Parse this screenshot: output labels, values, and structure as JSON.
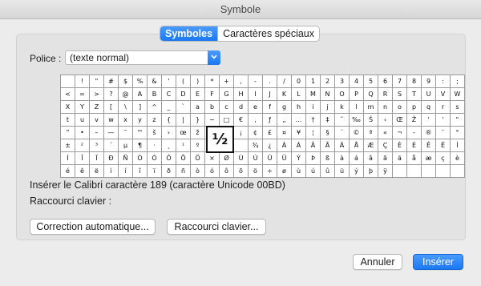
{
  "window": {
    "title": "Symbole"
  },
  "tabs": [
    {
      "label": "Symboles",
      "active": true
    },
    {
      "label": "Caractères spéciaux",
      "active": false
    }
  ],
  "police": {
    "label": "Police :",
    "value": "(texte normal)"
  },
  "symbol_grid": {
    "rows": [
      [
        "",
        "!",
        "\"",
        "#",
        "$",
        "%",
        "&",
        "'",
        "(",
        ")",
        "*",
        "+",
        ",",
        "-",
        ".",
        "/",
        "0",
        "1",
        "2",
        "3",
        "4",
        "5",
        "6",
        "7",
        "8",
        "9",
        ":",
        ";"
      ],
      [
        "<",
        "=",
        ">",
        "?",
        "@",
        "A",
        "B",
        "C",
        "D",
        "E",
        "F",
        "G",
        "H",
        "I",
        "J",
        "K",
        "L",
        "M",
        "N",
        "O",
        "P",
        "Q",
        "R",
        "S",
        "T",
        "U",
        "V",
        "W"
      ],
      [
        "X",
        "Y",
        "Z",
        "[",
        "\\",
        "]",
        "^",
        "_",
        "`",
        "a",
        "b",
        "c",
        "d",
        "e",
        "f",
        "g",
        "h",
        "i",
        "j",
        "k",
        "l",
        "m",
        "n",
        "o",
        "p",
        "q",
        "r",
        "s"
      ],
      [
        "t",
        "u",
        "v",
        "w",
        "x",
        "y",
        "z",
        "{",
        "|",
        "}",
        "~",
        "□",
        "€",
        ",",
        "ƒ",
        "„",
        "…",
        "†",
        "‡",
        "ˆ",
        "‰",
        "Š",
        "‹",
        "Œ",
        "Ž",
        "'",
        "'",
        "“"
      ],
      [
        "”",
        "•",
        "–",
        "—",
        "˜",
        "™",
        "š",
        "›",
        "œ",
        "ž",
        "Ÿ",
        "",
        "¡",
        "¢",
        "£",
        "¤",
        "¥",
        "¦",
        "§",
        "¨",
        "©",
        "ª",
        "«",
        "¬",
        "-",
        "®",
        "¯",
        "°"
      ],
      [
        "±",
        "²",
        "³",
        "´",
        "µ",
        "¶",
        "·",
        "¸",
        "¹",
        "º",
        "»",
        "¼",
        "",
        "¾",
        "¿",
        "À",
        "Á",
        "Â",
        "Ã",
        "Ä",
        "Å",
        "Æ",
        "Ç",
        "È",
        "É",
        "Ê",
        "Ë",
        "Ì"
      ],
      [
        "Í",
        "Î",
        "Ï",
        "Ð",
        "Ñ",
        "Ò",
        "Ó",
        "Ô",
        "Õ",
        "Ö",
        "×",
        "Ø",
        "Ù",
        "Ú",
        "Û",
        "Ü",
        "Ý",
        "Þ",
        "ß",
        "à",
        "á",
        "â",
        "ã",
        "ä",
        "å",
        "æ",
        "ç",
        "è"
      ],
      [
        "é",
        "ê",
        "ë",
        "ì",
        "í",
        "î",
        "ï",
        "ð",
        "ñ",
        "ò",
        "ó",
        "ô",
        "õ",
        "ö",
        "÷",
        "ø",
        "ù",
        "ú",
        "û",
        "ü",
        "ý",
        "þ",
        "ÿ",
        "",
        "",
        "",
        "",
        ""
      ]
    ],
    "selected_symbol": "½"
  },
  "info": {
    "insert_text": "Insérer le Calibri caractère 189 (caractère Unicode 00BD)",
    "shortcut_label": "Raccourci clavier :"
  },
  "buttons": {
    "autocorrect": "Correction automatique...",
    "keyboard_shortcut": "Raccourci clavier...",
    "cancel": "Annuler",
    "insert": "Insérer"
  },
  "colors": {
    "accent": "#1a78f0",
    "background": "#ececec"
  }
}
